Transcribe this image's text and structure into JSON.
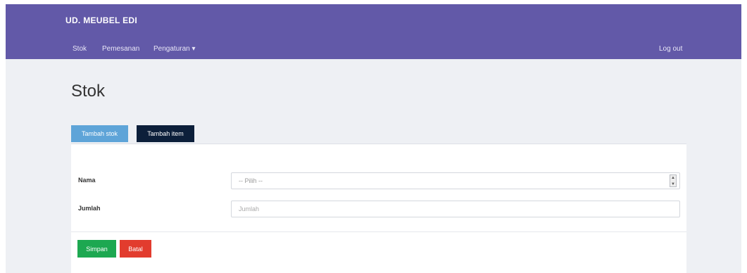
{
  "app": {
    "brand": "UD. MEUBEL EDI"
  },
  "nav": {
    "items": [
      {
        "label": "Stok"
      },
      {
        "label": "Pemesanan"
      },
      {
        "label": "Pengaturan ▾"
      }
    ],
    "logout_label": "Log out"
  },
  "page": {
    "title": "Stok"
  },
  "tabs": {
    "tambah_stok": "Tambah stok",
    "tambah_item": "Tambah item"
  },
  "form": {
    "nama_label": "Nama",
    "nama_select_value": "-- Pilih --",
    "jumlah_label": "Jumlah",
    "jumlah_placeholder": "Jumlah"
  },
  "buttons": {
    "simpan": "Simpan",
    "batal": "Batal"
  },
  "colors": {
    "navbar": "#6259a8",
    "tab_active": "#5ea4d8",
    "tab_dark": "#0c1f3a",
    "save": "#1da851",
    "cancel": "#e23c2e"
  }
}
